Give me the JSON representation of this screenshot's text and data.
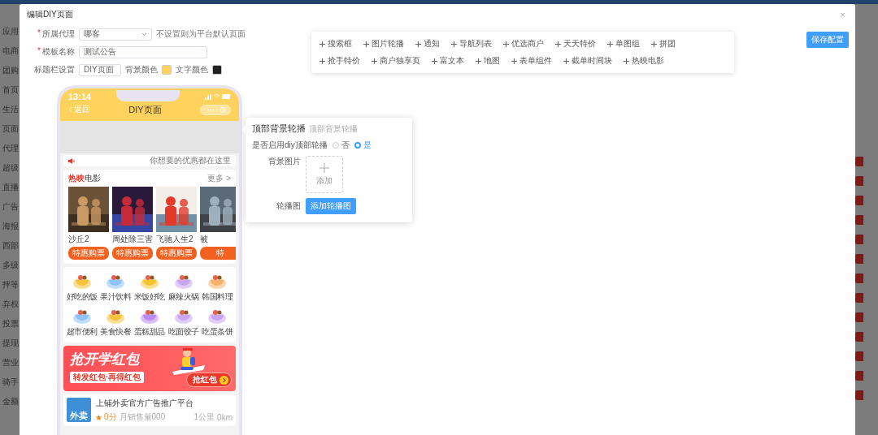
{
  "admin": {
    "sidebar_items": [
      "应用",
      "电商",
      "团购",
      "首页",
      "生活",
      "页面",
      "代理",
      "超级",
      "直播",
      "广告",
      "海报",
      "西部",
      "多级",
      "抨等",
      "弃权",
      "投票",
      "提现",
      "营业",
      "骑手",
      "金额"
    ]
  },
  "modal": {
    "title": "编辑DIY页面",
    "close": "×"
  },
  "form": {
    "agent": {
      "mark": "*",
      "label": "所属代理",
      "value": "哪客",
      "hint": "不设置则为平台默认页面"
    },
    "name": {
      "mark": "*",
      "label": "模板名称",
      "value": "测试公告"
    },
    "titlebar": {
      "label": "标题栏设置",
      "value": "DIY页面",
      "swatches": [
        {
          "label": "背景颜色",
          "color": "#ffd25e"
        },
        {
          "label": "文字颜色",
          "color": "#222222"
        }
      ]
    }
  },
  "components": [
    "搜索框",
    "图片轮播",
    "通知",
    "导航列表",
    "优选商户",
    "天天特价",
    "单图组",
    "拼团",
    "抢手特价",
    "商户独享页",
    "富文本",
    "地图",
    "表单组件",
    "截单时间块",
    "热映电影"
  ],
  "save_button": "保存配置",
  "phone": {
    "time": "13:14",
    "back": "返回",
    "title": "DIY页面",
    "notice": "你想要的优惠都在这里",
    "movies": {
      "title_hot": "热映",
      "title_rest": "电影",
      "more": "更多 >",
      "items": [
        {
          "name": "沙丘2",
          "button": "特惠购票"
        },
        {
          "name": "周处除三害",
          "button": "特惠购票"
        },
        {
          "name": "飞驰人生2",
          "button": "特惠购票"
        },
        {
          "name": "被",
          "button": "特"
        }
      ]
    },
    "categories": [
      {
        "label": "好吃的饭",
        "color": "#f6c23e"
      },
      {
        "label": "果汁饮料",
        "color": "#8fc3f5"
      },
      {
        "label": "米饭好吃",
        "color": "#f4c431"
      },
      {
        "label": "麻辣火锅",
        "color": "#c9a6f2"
      },
      {
        "label": "韩国料理",
        "color": "#f5b26b"
      },
      {
        "label": "超市便利",
        "color": "#8fc3f5"
      },
      {
        "label": "美食快餐",
        "color": "#f6c23e"
      },
      {
        "label": "蛋糕甜品",
        "color": "#b98af0"
      },
      {
        "label": "吃面饺子",
        "color": "#c9a6f2"
      },
      {
        "label": "吃蛋条饼",
        "color": "#c9a6f2"
      }
    ],
    "banner": {
      "title": "抢开学红包",
      "subtitle": "转发红包·再得红包",
      "button": "抢红包"
    },
    "shop": {
      "logo": "外卖",
      "name": "上铺外卖官方广告推广平台",
      "rating": "0分",
      "sales": "月销售量000",
      "distance": "1公里",
      "km": "0km"
    }
  },
  "popup": {
    "title": "顶部背景轮播",
    "caption": "顶部背景轮播",
    "enable_label": "是否启用diy顶部轮播",
    "options": [
      {
        "label": "否",
        "selected": false
      },
      {
        "label": "是",
        "selected": true
      }
    ],
    "image_label": "背景图片",
    "upload": "添加",
    "carousel_label": "轮播图",
    "carousel_button": "添加轮播图"
  }
}
